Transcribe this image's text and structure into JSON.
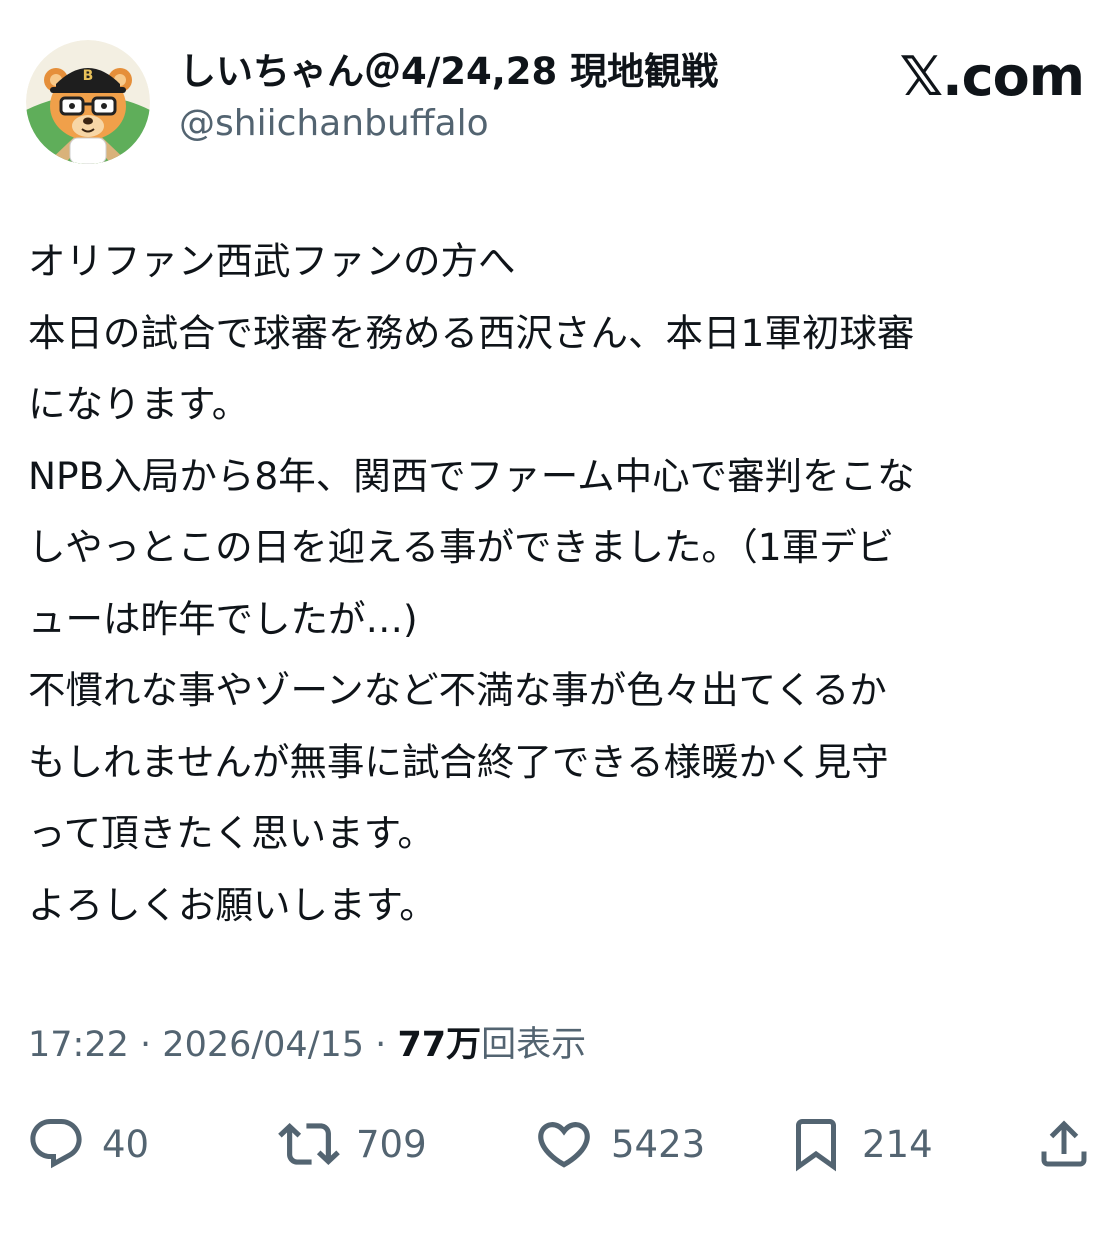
{
  "author": {
    "display_name": "しいちゃん＠4/24,28 現地観戦",
    "handle": "@shiichanbuffalo",
    "avatar_icon": "bear-mascot-avatar-icon"
  },
  "watermark": "𝕏.com",
  "tweet": {
    "lines": [
      "オリファン西武ファンの方へ",
      "本日の試合で球審を務める西沢さん、本日1軍初球審",
      "になります。",
      "NPB入局から8年、関西でファーム中心で審判をこな",
      "しやっとこの日を迎える事ができました。（1軍デビ",
      "ューは昨年でしたが…)",
      "不慣れな事やゾーンなど不満な事が色々出てくるか",
      "もしれませんが無事に試合終了できる様暖かく見守",
      "って頂きたく思います。",
      "よろしくお願いします。"
    ]
  },
  "meta": {
    "time": "17:22",
    "separator": "·",
    "date": "2026/04/15",
    "views_count": "77万",
    "views_label": "回表示"
  },
  "actions": {
    "replies": "40",
    "reposts": "709",
    "likes": "5423",
    "bookmarks": "214"
  },
  "colors": {
    "text_primary": "#0f1419",
    "text_secondary": "#536471",
    "avatar_bg_green": "#5fae5a",
    "avatar_bear_orange": "#f0a04a"
  }
}
